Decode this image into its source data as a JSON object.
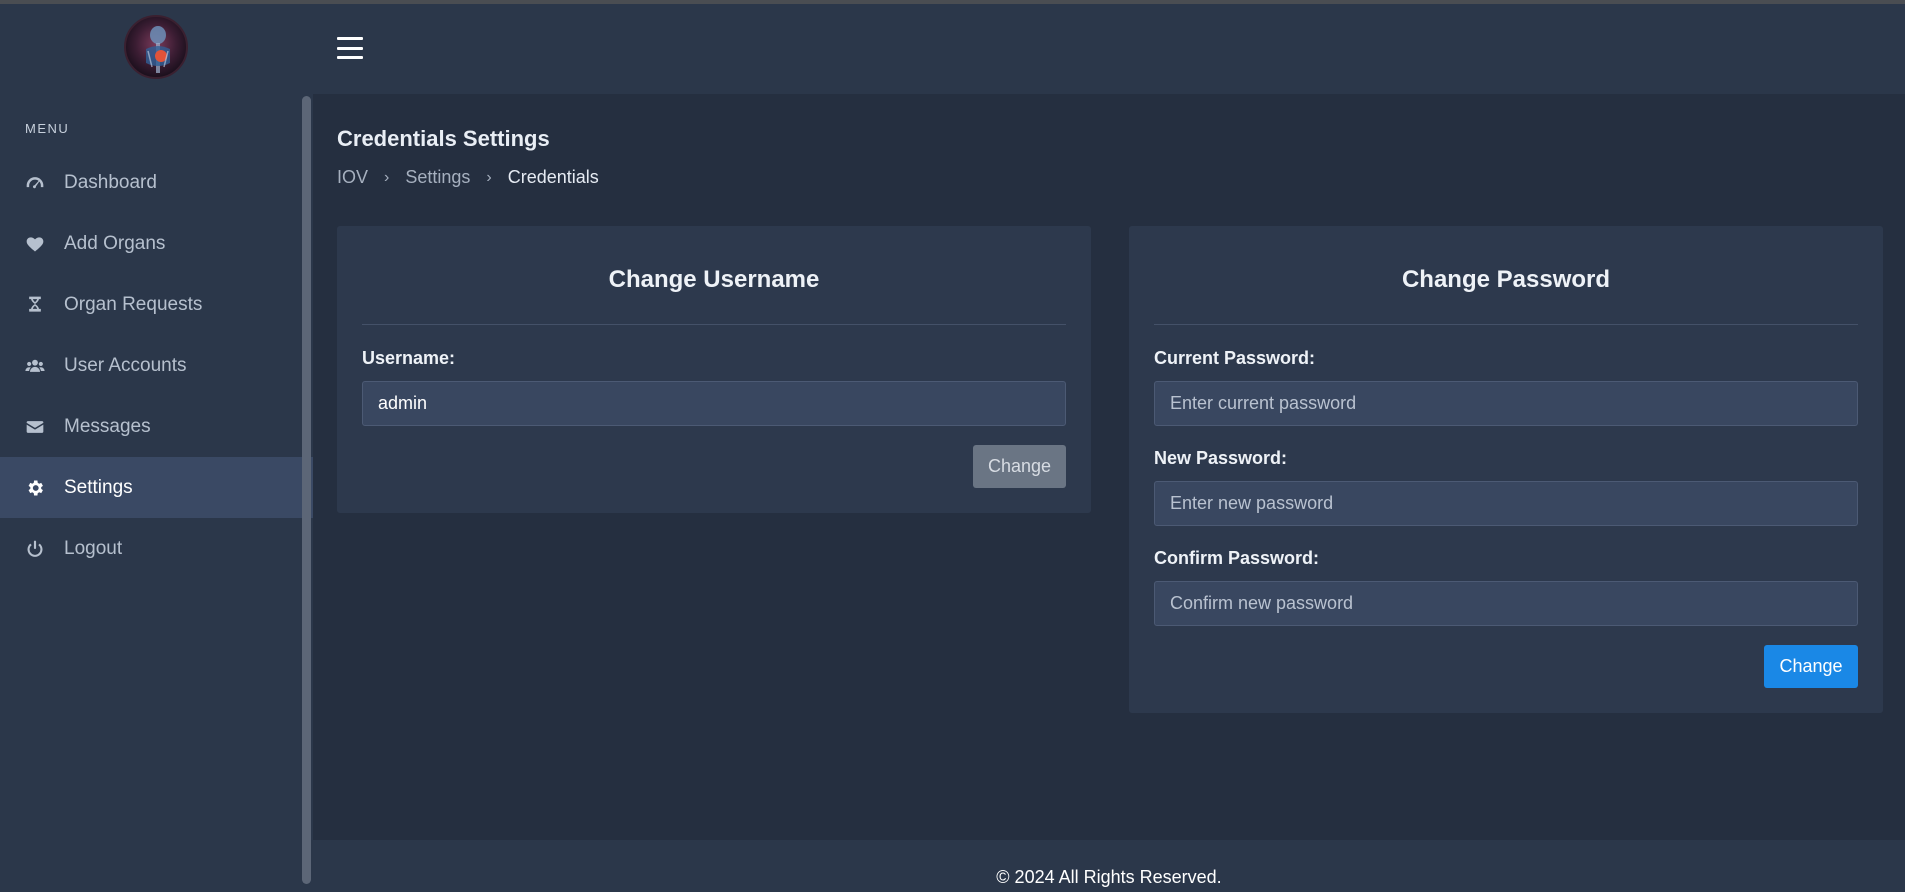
{
  "sidebar": {
    "menu_label": "MENU",
    "items": [
      {
        "label": "Dashboard",
        "icon": "gauge-icon",
        "active": false
      },
      {
        "label": "Add Organs",
        "icon": "heart-icon",
        "active": false
      },
      {
        "label": "Organ Requests",
        "icon": "dna-icon",
        "active": false
      },
      {
        "label": "User Accounts",
        "icon": "users-icon",
        "active": false
      },
      {
        "label": "Messages",
        "icon": "envelope-icon",
        "active": false
      },
      {
        "label": "Settings",
        "icon": "gear-icon",
        "active": true
      },
      {
        "label": "Logout",
        "icon": "power-icon",
        "active": false
      }
    ]
  },
  "header": {
    "menu_toggle_icon": "hamburger-icon"
  },
  "page": {
    "title": "Credentials Settings",
    "breadcrumb": [
      "IOV",
      "Settings",
      "Credentials"
    ]
  },
  "username_card": {
    "title": "Change Username",
    "label": "Username:",
    "value": "admin",
    "button": "Change"
  },
  "password_card": {
    "title": "Change Password",
    "current_label": "Current Password:",
    "current_placeholder": "Enter current password",
    "new_label": "New Password:",
    "new_placeholder": "Enter new password",
    "confirm_label": "Confirm Password:",
    "confirm_placeholder": "Confirm new password",
    "button": "Change"
  },
  "footer": {
    "text": "© 2024 All Rights Reserved."
  },
  "colors": {
    "sidebar_bg": "#2b374a",
    "page_bg": "#252f40",
    "card_bg": "#2d394d",
    "active_item_bg": "#3a4964",
    "primary": "#1a88e6"
  }
}
